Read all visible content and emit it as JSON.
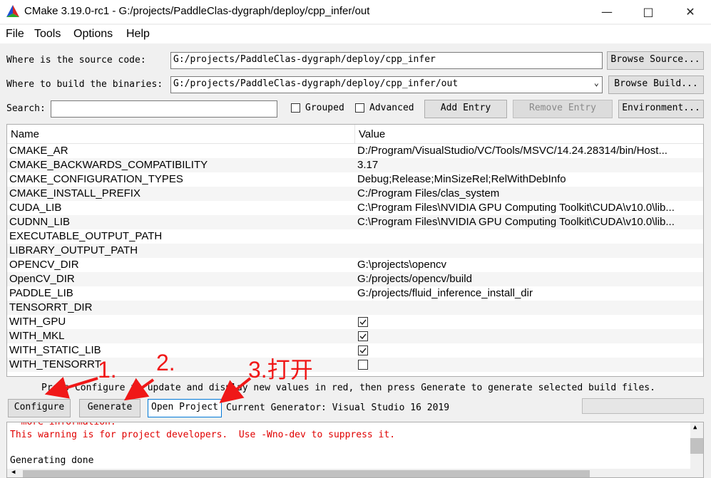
{
  "window": {
    "title": "CMake 3.19.0-rc1 - G:/projects/PaddleClas-dygraph/deploy/cpp_infer/out"
  },
  "menu": [
    "File",
    "Tools",
    "Options",
    "Help"
  ],
  "source": {
    "label": "Where is the source code:",
    "value": "G:/projects/PaddleClas-dygraph/deploy/cpp_infer",
    "browse_label": "Browse Source..."
  },
  "build": {
    "label": "Where to build the binaries:",
    "value": "G:/projects/PaddleClas-dygraph/deploy/cpp_infer/out",
    "browse_label": "Browse Build..."
  },
  "search": {
    "label": "Search:",
    "value": ""
  },
  "options": {
    "grouped": "Grouped",
    "advanced": "Advanced",
    "add_entry": "Add Entry",
    "remove_entry": "Remove Entry",
    "environment": "Environment..."
  },
  "table": {
    "headers": [
      "Name",
      "Value"
    ],
    "rows": [
      {
        "name": "CMAKE_AR",
        "value": "D:/Program/VisualStudio/VC/Tools/MSVC/14.24.28314/bin/Host..."
      },
      {
        "name": "CMAKE_BACKWARDS_COMPATIBILITY",
        "value": "3.17"
      },
      {
        "name": "CMAKE_CONFIGURATION_TYPES",
        "value": "Debug;Release;MinSizeRel;RelWithDebInfo"
      },
      {
        "name": "CMAKE_INSTALL_PREFIX",
        "value": "C:/Program Files/clas_system"
      },
      {
        "name": "CUDA_LIB",
        "value": "C:\\Program Files\\NVIDIA GPU Computing Toolkit\\CUDA\\v10.0\\lib..."
      },
      {
        "name": "CUDNN_LIB",
        "value": "C:\\Program Files\\NVIDIA GPU Computing Toolkit\\CUDA\\v10.0\\lib..."
      },
      {
        "name": "EXECUTABLE_OUTPUT_PATH",
        "value": ""
      },
      {
        "name": "LIBRARY_OUTPUT_PATH",
        "value": ""
      },
      {
        "name": "OPENCV_DIR",
        "value": "G:\\projects\\opencv"
      },
      {
        "name": "OpenCV_DIR",
        "value": "G:/projects/opencv/build"
      },
      {
        "name": "PADDLE_LIB",
        "value": "G:/projects/fluid_inference_install_dir"
      },
      {
        "name": "TENSORRT_DIR",
        "value": ""
      },
      {
        "name": "WITH_GPU",
        "checked": true
      },
      {
        "name": "WITH_MKL",
        "checked": true
      },
      {
        "name": "WITH_STATIC_LIB",
        "checked": true
      },
      {
        "name": "WITH_TENSORRT",
        "checked": false
      }
    ]
  },
  "hint": "Press Configure to update and display new values in red, then press Generate to generate selected build files.",
  "actions": {
    "configure": "Configure",
    "generate": "Generate",
    "open_project": "Open Project",
    "generator": "Current Generator: Visual Studio 16 2019"
  },
  "output": {
    "lines": [
      {
        "text": "  more information.",
        "color": "red"
      },
      {
        "text": "This warning is for project developers.  Use -Wno-dev to suppress it.",
        "color": "red"
      },
      {
        "text": "",
        "color": "black"
      },
      {
        "text": "Generating done",
        "color": "black"
      }
    ]
  },
  "annotations": [
    "1.",
    "2.",
    "3.打开"
  ]
}
